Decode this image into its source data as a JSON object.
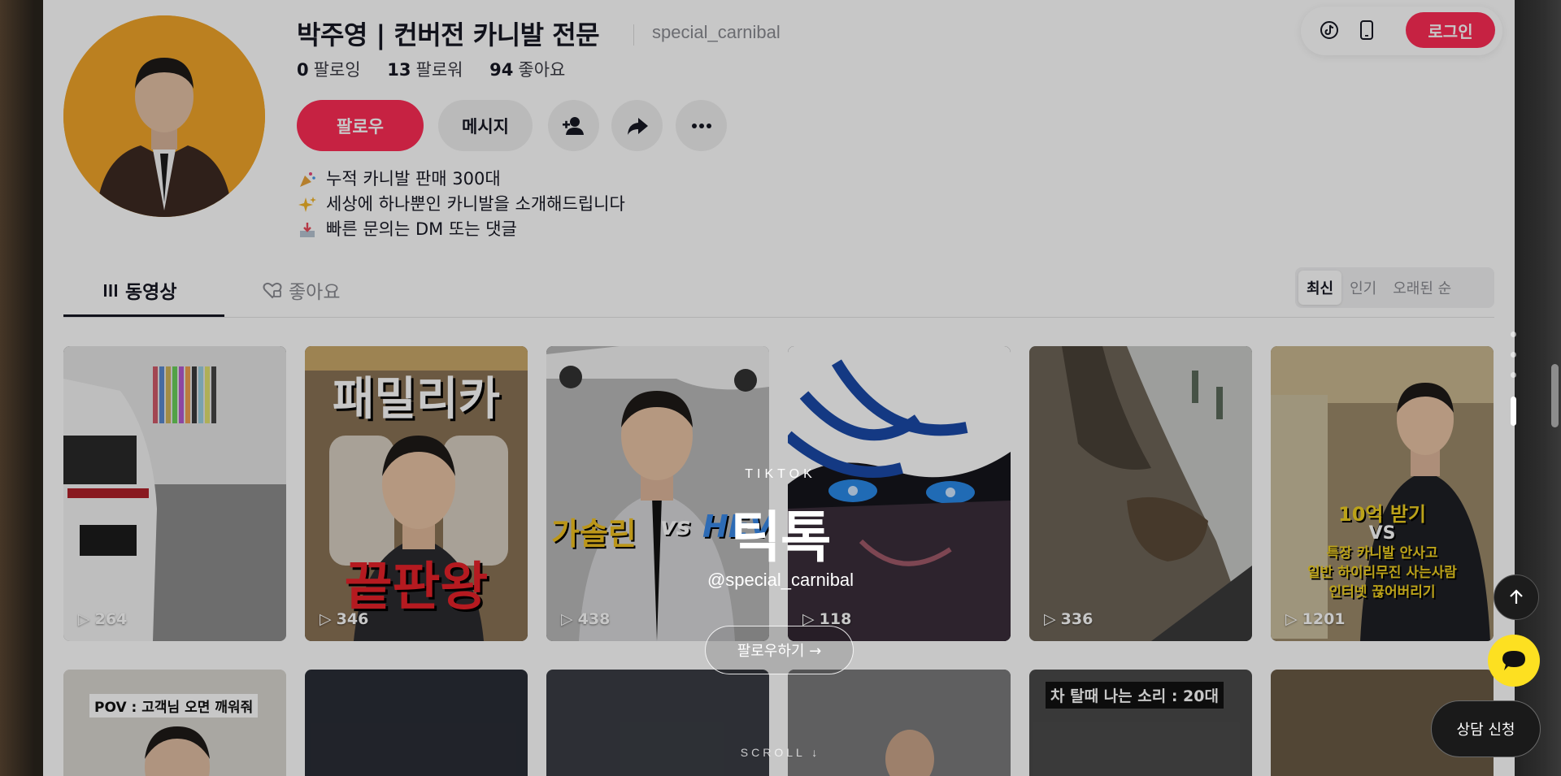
{
  "profile": {
    "name": "박주영 | 컨버전 카니발 전문",
    "handle": "special_carnibal",
    "stats": [
      {
        "value": "0",
        "label": "팔로잉"
      },
      {
        "value": "13",
        "label": "팔로워"
      },
      {
        "value": "94",
        "label": "좋아요"
      }
    ],
    "follow_label": "팔로우",
    "message_label": "메시지",
    "bio": [
      {
        "icon": "party-popper-icon",
        "text": "누적 카니발 판매 300대"
      },
      {
        "icon": "sparkles-icon",
        "text": "세상에 하나뿐인 카니발을 소개해드립니다"
      },
      {
        "icon": "inbox-tray-icon",
        "text": "빠른 문의는 DM 또는 댓글"
      }
    ]
  },
  "topbar": {
    "login_label": "로그인",
    "icons": [
      "tiktok-icon",
      "mobile-phone-icon"
    ]
  },
  "tabs": {
    "videos": "동영상",
    "liked": "좋아요",
    "sort": [
      "최신",
      "인기",
      "오래된 순"
    ],
    "active_sort": "최신"
  },
  "videos": [
    {
      "views": "264"
    },
    {
      "views": "346",
      "caption_top": "패밀리카",
      "caption_bottom": "끝판왕"
    },
    {
      "views": "438",
      "caption_left": "가솔린",
      "caption_vs": "vs",
      "caption_right": "HEV"
    },
    {
      "views": "118"
    },
    {
      "views": "336"
    },
    {
      "views": "1201",
      "caption": [
        "10억 받기",
        "VS",
        "특장 카니발 안사고",
        "일반 하이리무진 사는사람",
        "인터넷 끊어버리기"
      ]
    }
  ],
  "videos_row2": [
    {
      "caption": "POV : 고객님 오면 깨워줘"
    },
    {},
    {},
    {},
    {
      "caption": "차 탈때 나는 소리 : 20대"
    },
    {}
  ],
  "overlay": {
    "kicker": "TIKTOK",
    "title": "틱톡",
    "handle": "@special_carnibal",
    "button": "팔로우하기 →",
    "scroll": "SCROLL ↓"
  },
  "floating": {
    "consult": "상담 신청"
  },
  "colors": {
    "brand_red": "#fe2c55",
    "kakao_yellow": "#fde021",
    "avatar_bg": "#f0a52a"
  }
}
